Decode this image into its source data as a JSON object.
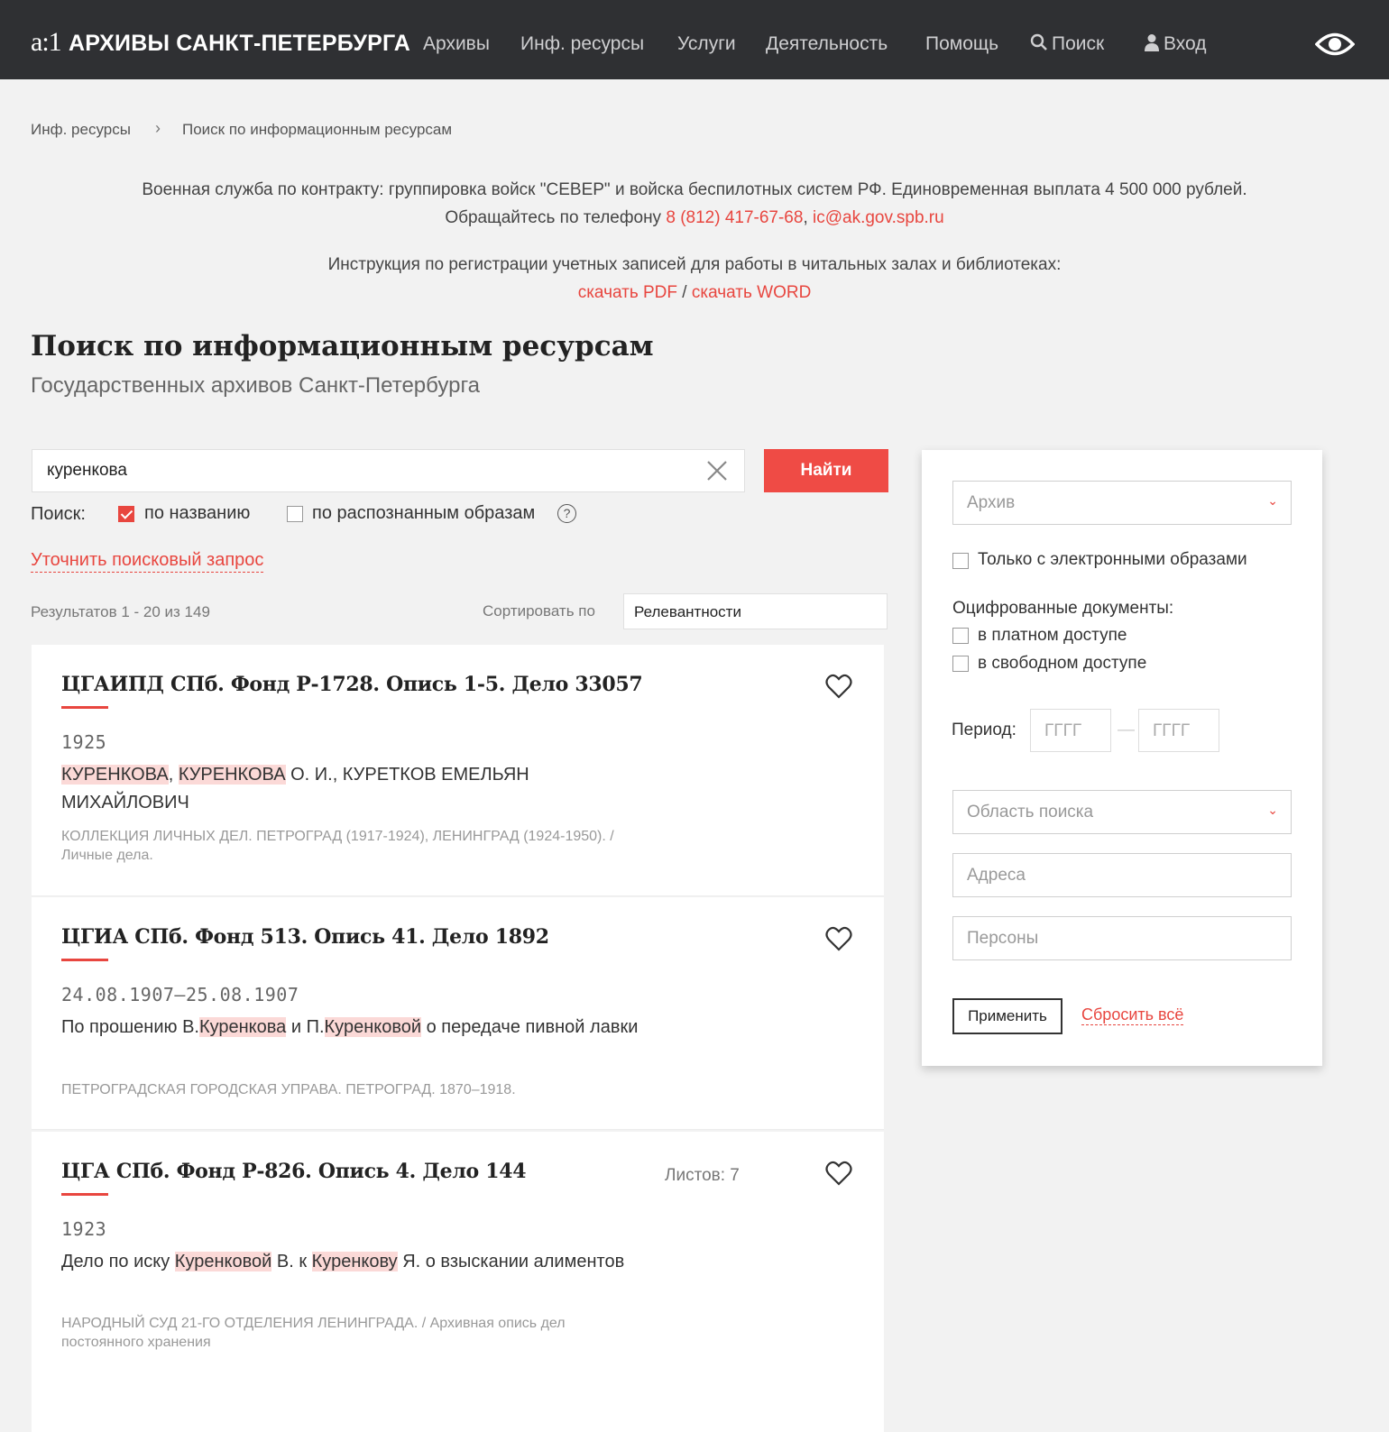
{
  "header": {
    "logo": "a:1",
    "site_name": "АРХИВЫ САНКТ-ПЕТЕРБУРГА",
    "nav": [
      "Архивы",
      "Инф. ресурсы",
      "Услуги",
      "Деятельность",
      "Помощь"
    ],
    "search_label": "Поиск",
    "login_label": "Вход"
  },
  "breadcrumb": [
    "Инф. ресурсы",
    "Поиск по информационным ресурсам"
  ],
  "notice1": {
    "line1": "Военная служба по контракту: группировка войск \"СЕВЕР\" и войска беспилотных систем РФ. Единовременная выплата 4 500 000 рублей.",
    "line2_prefix": "Обращайтесь по телефону ",
    "phone": "8 (812) 417-67-68",
    "comma": ", ",
    "email": "ic@ak.gov.spb.ru"
  },
  "notice2": {
    "line1": "Инструкция по регистрации учетных записей для работы в читальных залах и библиотеках:",
    "pdf": "скачать PDF",
    "slash": " / ",
    "word": "скачать WORD"
  },
  "page_title": "Поиск по информационным ресурсам",
  "page_subtitle": "Государственных архивов Санкт-Петербурга",
  "search": {
    "value": "куренкова",
    "button": "Найти",
    "mode_label": "Поиск:",
    "opt_title": "по названию",
    "opt_images": "по распознанным образам",
    "help": "?",
    "refine": "Уточнить поисковый запрос"
  },
  "results": {
    "count": "Результатов 1 - 20 из 149",
    "sort_label": "Сортировать по",
    "sort_value": "Релевантности",
    "items": [
      {
        "title": "ЦГАИПД СПб. Фонд Р-1728. Опись 1-5. Дело 33057",
        "date": "1925",
        "hl1": "КУРЕНКОВА",
        "t1": ", ",
        "hl2": "КУРЕНКОВА",
        "t2": " О. И., КУРЕТКОВ ЕМЕЛЬЯН МИХАЙЛОВИЧ",
        "source": "КОЛЛЕКЦИЯ ЛИЧНЫХ ДЕЛ. ПЕТРОГРАД (1917-1924), ЛЕНИНГРАД (1924-1950). / Личные дела."
      },
      {
        "title": "ЦГИА СПб. Фонд 513. Опись 41. Дело 1892",
        "date": "24.08.1907–25.08.1907",
        "t0": "По прошению В.",
        "hl1": "Куренкова",
        "t1": " и П.",
        "hl2": "Куренковой",
        "t2": " о передаче пивной лавки",
        "source": "ПЕТРОГРАДСКАЯ ГОРОДСКАЯ УПРАВА. ПЕТРОГРАД. 1870–1918."
      },
      {
        "title": "ЦГА СПб. Фонд Р-826. Опись 4. Дело 144",
        "sheets": "Листов: 7",
        "date": "1923",
        "t0": "Дело по иску ",
        "hl1": "Куренковой",
        "t1": " В. к ",
        "hl2": "Куренкову",
        "t2": " Я. о взыскании алиментов",
        "source": "НАРОДНЫЙ СУД 21-ГО ОТДЕЛЕНИЯ ЛЕНИНГРАДА. / Архивная опись дел постоянного хранения"
      }
    ]
  },
  "filters": {
    "archive_placeholder": "Архив",
    "only_images": "Только с электронными образами",
    "digitized_label": "Оцифрованные документы:",
    "paid": "в платном доступе",
    "free": "в свободном доступе",
    "period_label": "Период:",
    "year_placeholder": "ГГГГ",
    "dash": "—",
    "scope_placeholder": "Область поиска",
    "addresses_placeholder": "Адреса",
    "persons_placeholder": "Персоны",
    "apply": "Применить",
    "reset": "Сбросить всё"
  }
}
